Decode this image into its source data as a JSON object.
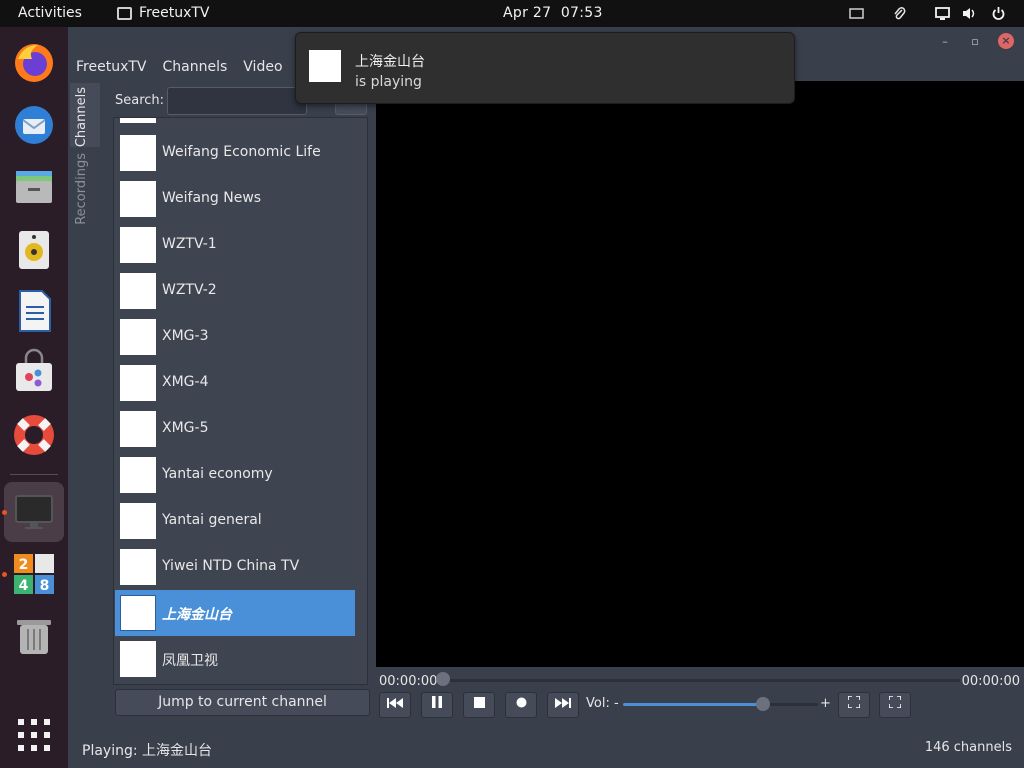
{
  "topbar": {
    "activities": "Activities",
    "app_name": "FreetuxTV",
    "date": "Apr 27",
    "time": "07:53"
  },
  "window": {
    "menu": [
      "FreetuxTV",
      "Channels",
      "Video"
    ],
    "tabs": [
      "Channels",
      "Recordings"
    ],
    "search_label": "Search:",
    "search_value": "",
    "channels": [
      {
        "name": "Weifang Economic Life",
        "selected": false
      },
      {
        "name": "Weifang News",
        "selected": false
      },
      {
        "name": "WZTV-1",
        "selected": false
      },
      {
        "name": "WZTV-2",
        "selected": false
      },
      {
        "name": "XMG-3",
        "selected": false
      },
      {
        "name": "XMG-4",
        "selected": false
      },
      {
        "name": "XMG-5",
        "selected": false
      },
      {
        "name": "Yantai economy",
        "selected": false
      },
      {
        "name": "Yantai general",
        "selected": false
      },
      {
        "name": "Yiwei NTD China TV",
        "selected": false
      },
      {
        "name": "上海金山台",
        "selected": true
      },
      {
        "name": "凤凰卫视",
        "selected": false
      }
    ],
    "jump_button": "Jump to current channel",
    "time_elapsed": "00:00:00",
    "time_total": "00:00:00",
    "volume_label": "Vol:",
    "volume_minus": "-",
    "volume_plus": "+",
    "volume_level": 0.72,
    "status_playing": "Playing: 上海金山台",
    "status_count": "146 channels"
  },
  "notification": {
    "title": "上海金山台",
    "body": "is playing"
  },
  "colors": {
    "accent": "#4a90d9",
    "dock_bg": "#2b1d27",
    "window_bg": "#3a3f4c",
    "close_button": "#e06666",
    "dock_running_dot": "#e95420"
  }
}
